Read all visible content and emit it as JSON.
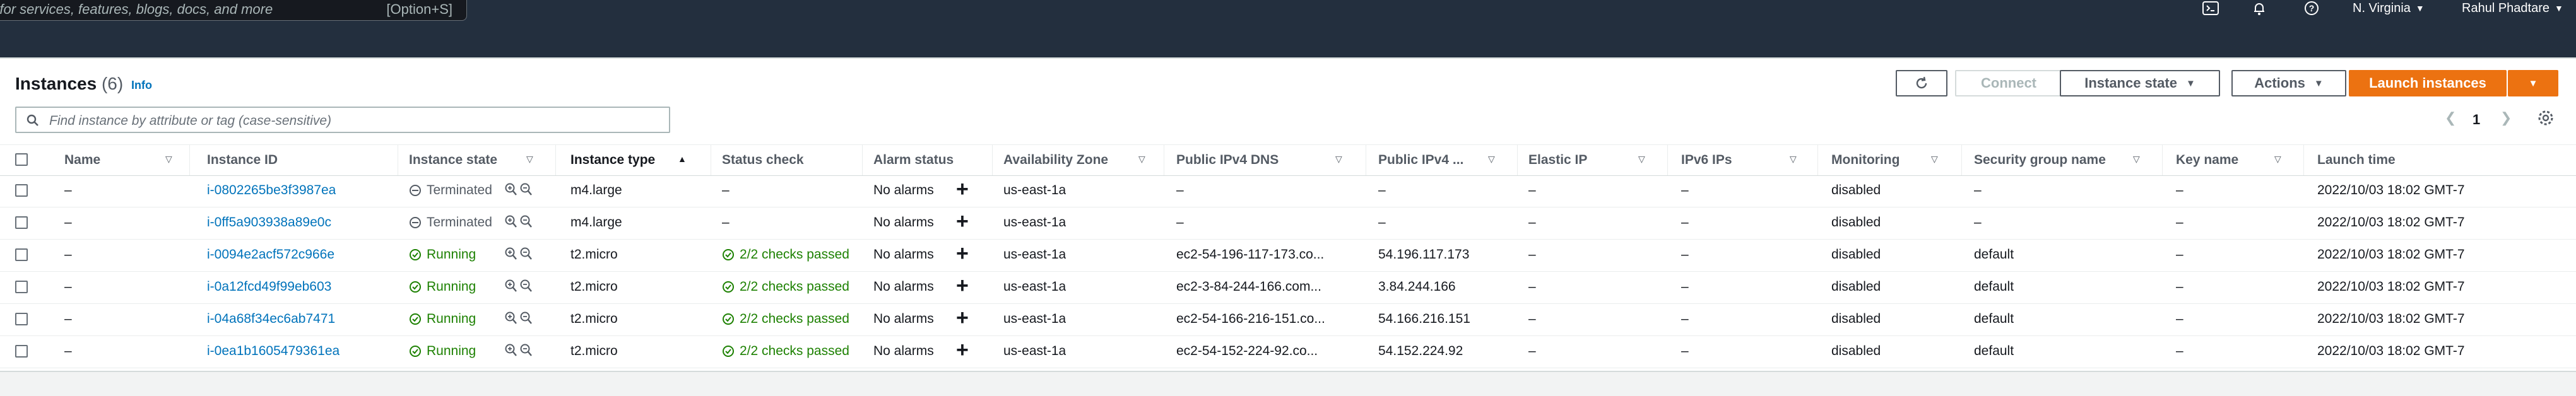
{
  "topnav": {
    "search_placeholder": "h for services, features, blogs, docs, and more",
    "search_shortcut": "[Option+S]",
    "region": "N. Virginia",
    "user": "Rahul Phadtare",
    "icons": [
      "cloudshell-icon",
      "bell-icon",
      "help-icon"
    ]
  },
  "header": {
    "title": "Instances",
    "count": "(6)",
    "info": "Info"
  },
  "toolbar": {
    "connect": "Connect",
    "instance_state": "Instance state",
    "actions": "Actions",
    "launch": "Launch instances"
  },
  "filter": {
    "placeholder": "Find instance by attribute or tag (case-sensitive)"
  },
  "pagination": {
    "page": "1"
  },
  "columns": {
    "name": "Name",
    "instance_id": "Instance ID",
    "instance_state": "Instance state",
    "instance_type": "Instance type",
    "status_check": "Status check",
    "alarm_status": "Alarm status",
    "az": "Availability Zone",
    "dns": "Public IPv4 DNS",
    "ip": "Public IPv4 ...",
    "elastic_ip": "Elastic IP",
    "ipv6": "IPv6 IPs",
    "monitoring": "Monitoring",
    "sg": "Security group name",
    "key": "Key name",
    "launch": "Launch time"
  },
  "rows": [
    {
      "name": "–",
      "id": "i-0802265be3f3987ea",
      "state": "Terminated",
      "type": "m4.large",
      "status": "–",
      "alarm": "No alarms",
      "az": "us-east-1a",
      "dns": "–",
      "ip": "–",
      "eip": "–",
      "ipv6": "–",
      "monitoring": "disabled",
      "sg": "–",
      "key": "–",
      "launch": "2022/10/03 18:02 GMT-7"
    },
    {
      "name": "–",
      "id": "i-0ff5a903938a89e0c",
      "state": "Terminated",
      "type": "m4.large",
      "status": "–",
      "alarm": "No alarms",
      "az": "us-east-1a",
      "dns": "–",
      "ip": "–",
      "eip": "–",
      "ipv6": "–",
      "monitoring": "disabled",
      "sg": "–",
      "key": "–",
      "launch": "2022/10/03 18:02 GMT-7"
    },
    {
      "name": "–",
      "id": "i-0094e2acf572c966e",
      "state": "Running",
      "type": "t2.micro",
      "status": "2/2 checks passed",
      "alarm": "No alarms",
      "az": "us-east-1a",
      "dns": "ec2-54-196-117-173.co...",
      "ip": "54.196.117.173",
      "eip": "–",
      "ipv6": "–",
      "monitoring": "disabled",
      "sg": "default",
      "key": "–",
      "launch": "2022/10/03 18:02 GMT-7"
    },
    {
      "name": "–",
      "id": "i-0a12fcd49f99eb603",
      "state": "Running",
      "type": "t2.micro",
      "status": "2/2 checks passed",
      "alarm": "No alarms",
      "az": "us-east-1a",
      "dns": "ec2-3-84-244-166.com...",
      "ip": "3.84.244.166",
      "eip": "–",
      "ipv6": "–",
      "monitoring": "disabled",
      "sg": "default",
      "key": "–",
      "launch": "2022/10/03 18:02 GMT-7"
    },
    {
      "name": "–",
      "id": "i-04a68f34ec6ab7471",
      "state": "Running",
      "type": "t2.micro",
      "status": "2/2 checks passed",
      "alarm": "No alarms",
      "az": "us-east-1a",
      "dns": "ec2-54-166-216-151.co...",
      "ip": "54.166.216.151",
      "eip": "–",
      "ipv6": "–",
      "monitoring": "disabled",
      "sg": "default",
      "key": "–",
      "launch": "2022/10/03 18:02 GMT-7"
    },
    {
      "name": "–",
      "id": "i-0ea1b1605479361ea",
      "state": "Running",
      "type": "t2.micro",
      "status": "2/2 checks passed",
      "alarm": "No alarms",
      "az": "us-east-1a",
      "dns": "ec2-54-152-224-92.co...",
      "ip": "54.152.224.92",
      "eip": "–",
      "ipv6": "–",
      "monitoring": "disabled",
      "sg": "default",
      "key": "–",
      "launch": "2022/10/03 18:02 GMT-7"
    }
  ],
  "colors": {
    "nav_bg": "#232f3e",
    "link": "#0073bb",
    "running": "#1d8102",
    "primary": "#ec7211"
  }
}
